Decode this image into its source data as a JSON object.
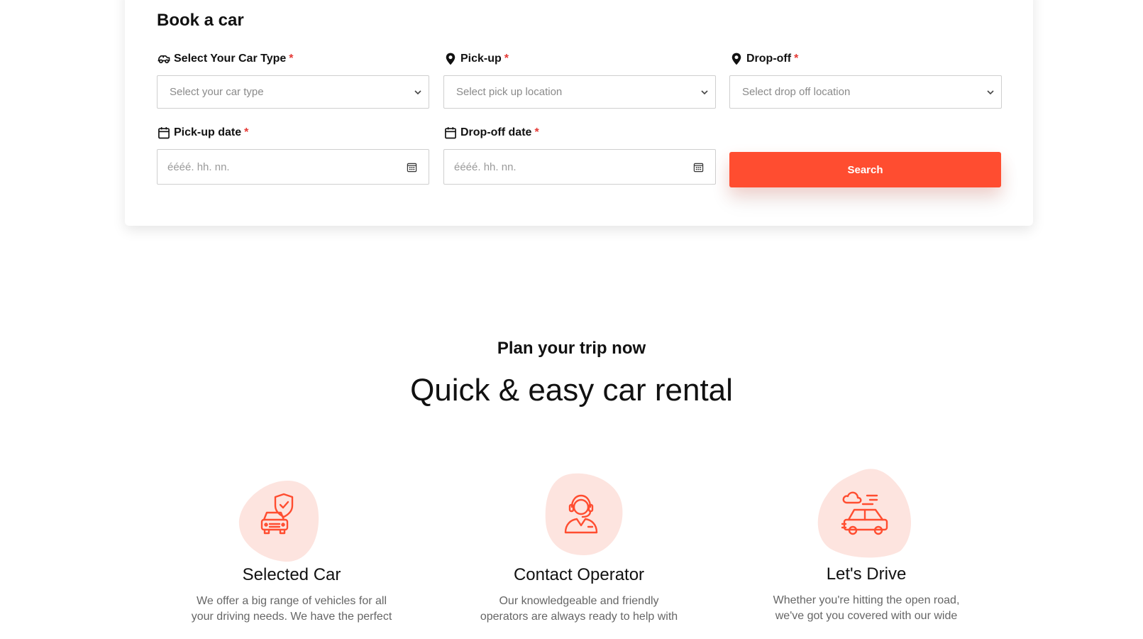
{
  "booking": {
    "title": "Book a car",
    "required_marker": "*",
    "car_type": {
      "label": "Select Your Car Type",
      "placeholder": "Select your car type"
    },
    "pickup": {
      "label": "Pick-up",
      "placeholder": "Select pick up location"
    },
    "dropoff": {
      "label": "Drop-off",
      "placeholder": "Select drop off location"
    },
    "pickup_date": {
      "label": "Pick-up date",
      "placeholder": "éééé. hh. nn."
    },
    "dropoff_date": {
      "label": "Drop-off date",
      "placeholder": "éééé. hh. nn."
    },
    "search_label": "Search"
  },
  "plan": {
    "subtitle": "Plan your trip now",
    "title": "Quick & easy car rental",
    "features": [
      {
        "title": "Selected Car",
        "text_line1": "We offer a big range of vehicles for all",
        "text_line2": "your driving needs. We have the perfect",
        "icon": "car-shield-icon"
      },
      {
        "title": "Contact Operator",
        "text_line1": "Our knowledgeable and friendly",
        "text_line2": "operators are always ready to help with",
        "icon": "operator-headset-icon"
      },
      {
        "title": "Let's Drive",
        "text_line1": "Whether you're hitting the open road,",
        "text_line2": "we've got you covered with our wide",
        "icon": "driving-car-icon"
      }
    ]
  },
  "colors": {
    "accent": "#ff4d30",
    "accent_soft": "#fde4df",
    "required": "#e53935"
  }
}
